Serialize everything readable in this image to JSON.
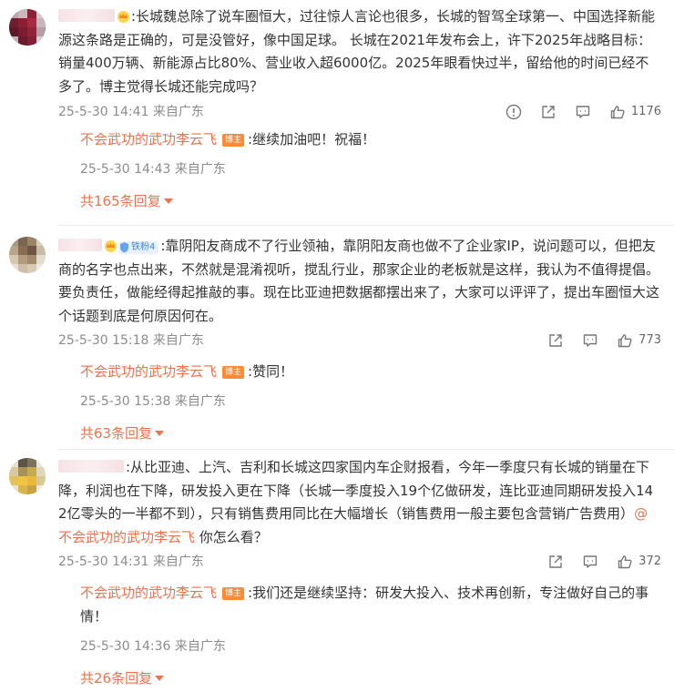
{
  "comments": [
    {
      "badge": "",
      "text": ":长城魏总除了说车圈恒大，过往惊人言论也很多，长城的智驾全球第一、中国选择新能源这条路是正确的，可是没管好，像中国足球。 长城在2021年发布会上，许下2025年战略目标：销量400万辆、新能源占比80%、营业收入超6000亿。2025年眼看快过半，留给他的时间已经不多了。博主觉得长城还能完成吗？",
      "time": "25-5-30 14:41 来自广东",
      "likes": "1176",
      "reply": {
        "author": "不会武功的武功李云飞",
        "badge": "博主",
        "text": ":继续加油吧！祝福！",
        "time": "25-5-30 14:43 来自广东"
      },
      "more": "共165条回复"
    },
    {
      "badge": "铁粉4",
      "text": ":靠阴阳友商成不了行业领袖，靠阴阳友商也做不了企业家IP，说问题可以，但把友商的名字也点出来，不然就是混淆视听，搅乱行业，那家企业的老板就是这样，我认为不值得提倡。要负责任，做能经得起推敲的事。现在比亚迪把数据都摆出来了，大家可以评评了，提出车圈恒大这个话题到底是何原因何在。",
      "time": "25-5-30 15:18 来自广东",
      "likes": "773",
      "reply": {
        "author": "不会武功的武功李云飞",
        "badge": "博主",
        "text": ":赞同！",
        "time": "25-5-30 15:38 来自广东"
      },
      "more": "共63条回复"
    },
    {
      "badge": "",
      "text": ":从比亚迪、上汽、吉利和长城这四家国内车企财报看，今年一季度只有长城的销量在下降，利润也在下降，研发投入更在下降（长城一季度投入19个亿做研发，连比亚迪同期研发投入142亿零头的一半都不到），只有销售费用同比在大幅增长（销售费用一般主要包含营销广告费用）",
      "mention": "@不会武功的武功李云飞",
      "tail": " 你怎么看？",
      "time": "25-5-30 14:31 来自广东",
      "likes": "372",
      "reply": {
        "author": "不会武功的武功李云飞",
        "badge": "博主",
        "text": ":我们还是继续坚持：研发大投入、技术再创新，专注做好自己的事情！",
        "time": "25-5-30 14:36 来自广东"
      },
      "more": "共26条回复"
    }
  ],
  "colors": {
    "accent": "#eb7350",
    "meta": "#8c8c8c",
    "blogger_badge": "#ff8a34"
  },
  "icons": [
    "report-icon",
    "share-icon",
    "comment-icon",
    "like-icon"
  ]
}
